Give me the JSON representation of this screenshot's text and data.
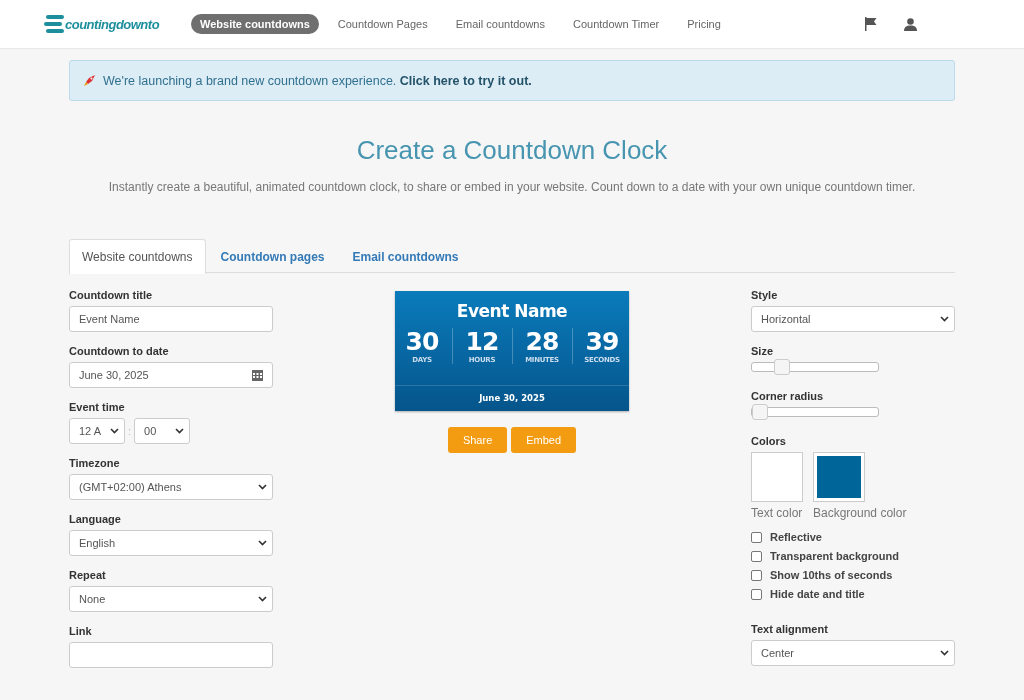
{
  "header": {
    "logo": "countingdownto",
    "nav": [
      {
        "label": "Website countdowns",
        "selected": true
      },
      {
        "label": "Countdown Pages",
        "selected": false
      },
      {
        "label": "Email countdowns",
        "selected": false
      },
      {
        "label": "Countdown Timer",
        "selected": false
      },
      {
        "label": "Pricing",
        "selected": false
      }
    ]
  },
  "banner": {
    "text": "We're launching a brand new countdown experience.",
    "link": "Click here to try it out."
  },
  "title": "Create a Countdown Clock",
  "subtitle": "Instantly create a beautiful, animated countdown clock, to share or embed in your website. Count down to a date with your own unique countdown timer.",
  "tabs": [
    {
      "label": "Website countdowns",
      "selected": true
    },
    {
      "label": "Countdown pages",
      "selected": false
    },
    {
      "label": "Email countdowns",
      "selected": false
    }
  ],
  "left_fields": [
    {
      "kind": "text",
      "label": "Countdown title",
      "value": "Event Name"
    },
    {
      "kind": "date",
      "label": "Countdown to date",
      "value": "June 30, 2025"
    },
    {
      "kind": "time",
      "label": "Event time",
      "hour": "12 A",
      "separator": ":",
      "minute": "00"
    },
    {
      "kind": "select",
      "label": "Timezone",
      "value": "(GMT+02:00) Athens"
    },
    {
      "kind": "select",
      "label": "Language",
      "value": "English"
    },
    {
      "kind": "select",
      "label": "Repeat",
      "value": "None"
    },
    {
      "kind": "text",
      "label": "Link"
    }
  ],
  "preview": {
    "title": "Event Name",
    "units": [
      {
        "value": "30",
        "label": "DAYS"
      },
      {
        "value": "12",
        "label": "HOURS"
      },
      {
        "value": "28",
        "label": "MINUTES"
      },
      {
        "value": "39",
        "label": "SECONDS"
      }
    ],
    "date": "June 30, 2025",
    "buttons": [
      "Share",
      "Embed"
    ]
  },
  "right_fields": [
    {
      "kind": "select",
      "label": "Style",
      "value": "Horizontal"
    },
    {
      "kind": "slider",
      "label": "Size",
      "level": 0.2
    },
    {
      "kind": "slider",
      "label": "Corner radius",
      "level": 0
    },
    {
      "kind": "colors",
      "label": "Colors",
      "swatches": [
        {
          "label": "Text color",
          "color": "#ffffff"
        },
        {
          "label": "Background color",
          "color": "#006699"
        }
      ]
    },
    {
      "kind": "checks",
      "items": [
        {
          "label": "Reflective",
          "checked": false
        },
        {
          "label": "Transparent background",
          "checked": false
        },
        {
          "label": "Show 10ths of seconds",
          "checked": false
        },
        {
          "label": "Hide date and title",
          "checked": false
        }
      ]
    },
    {
      "kind": "select",
      "label": "Text alignment",
      "value": "Center"
    }
  ]
}
